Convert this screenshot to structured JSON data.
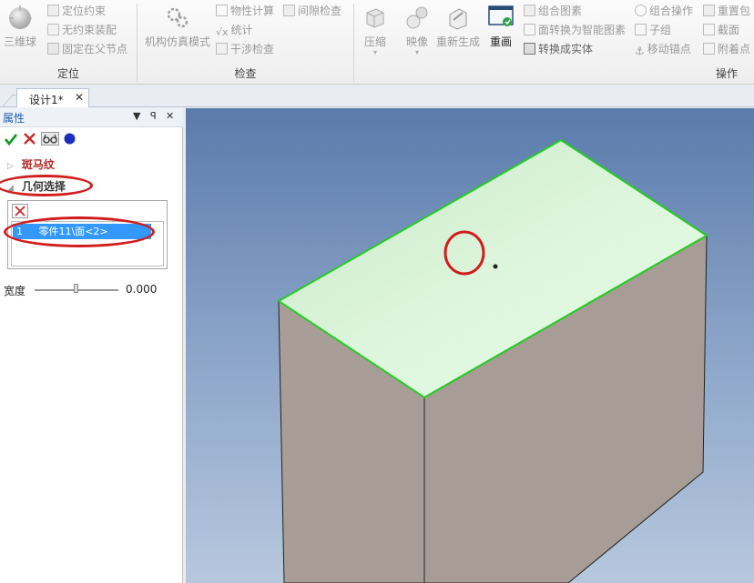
{
  "ribbon": {
    "groups": [
      {
        "label": "定位"
      },
      {
        "label": "检查"
      },
      {
        "label": "操作"
      }
    ],
    "positioning": {
      "big_label": "三维球",
      "items": [
        "定位约束",
        "无约束装配",
        "固定在父节点"
      ]
    },
    "inspection": {
      "big_label": "机构仿真模式",
      "items": [
        "物性计算",
        "间隙检查",
        "统计",
        "干涉检查"
      ]
    },
    "operations": {
      "big_buttons": [
        "压缩",
        "映像",
        "重新生成",
        "重画"
      ],
      "col1": [
        "组合图素",
        "面转换为智能图素",
        "转换成实体"
      ],
      "col2": [
        "组合操作",
        "子组",
        "移动锚点"
      ],
      "col3": [
        "重置包",
        "截面",
        "附着点"
      ]
    }
  },
  "document_tab": {
    "title": "设计1*",
    "close": "✕"
  },
  "panel": {
    "title": "属性",
    "header_buttons": [
      "▼",
      "ꟼ",
      "✕"
    ],
    "tree": [
      {
        "label": "斑马纹"
      },
      {
        "label": "几何选择"
      }
    ],
    "selection": {
      "row_index": "1",
      "row_text": "零件11\\面<2>"
    },
    "width": {
      "label": "宽度",
      "value": "0.000",
      "slider_fraction": 0.5
    }
  },
  "colors": {
    "selected_face": "#dff7df",
    "edge_highlight": "#22cc22",
    "box_side": "#a89e97",
    "annotation": "#d21d1d",
    "panel_title": "#1d5fb3",
    "selection_row": "#3399ff"
  },
  "icons": [
    "sphere-icon",
    "check-icon",
    "cancel-icon",
    "glasses-icon",
    "blue-dot-icon",
    "clear-selection-icon"
  ]
}
